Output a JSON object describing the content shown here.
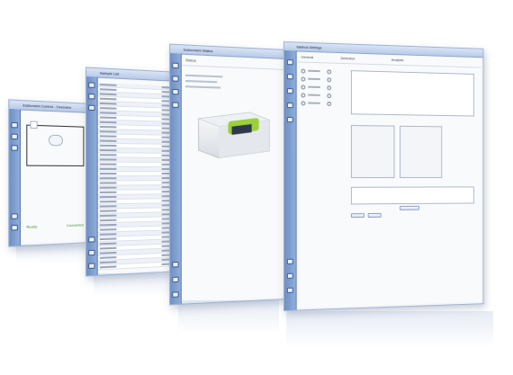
{
  "windows": [
    {
      "id": "diagram-window",
      "title": "Instrument Control - Overview",
      "status_items": [
        "Ready",
        "Connected"
      ]
    },
    {
      "id": "list-window",
      "title": "Sample List",
      "row_count": 40
    },
    {
      "id": "instrument-window",
      "title": "Instrument Status",
      "status_label": "Status"
    },
    {
      "id": "settings-window",
      "title": "Method Settings",
      "radio_count": 5,
      "tabs": [
        "General",
        "Detection",
        "Analysis"
      ]
    }
  ],
  "colors": {
    "sidebar": "#7b9bcf",
    "titlebar": "#c9d8f0",
    "window_bg": "#f4f5f7",
    "instrument_accent": "#9ccf3a"
  }
}
